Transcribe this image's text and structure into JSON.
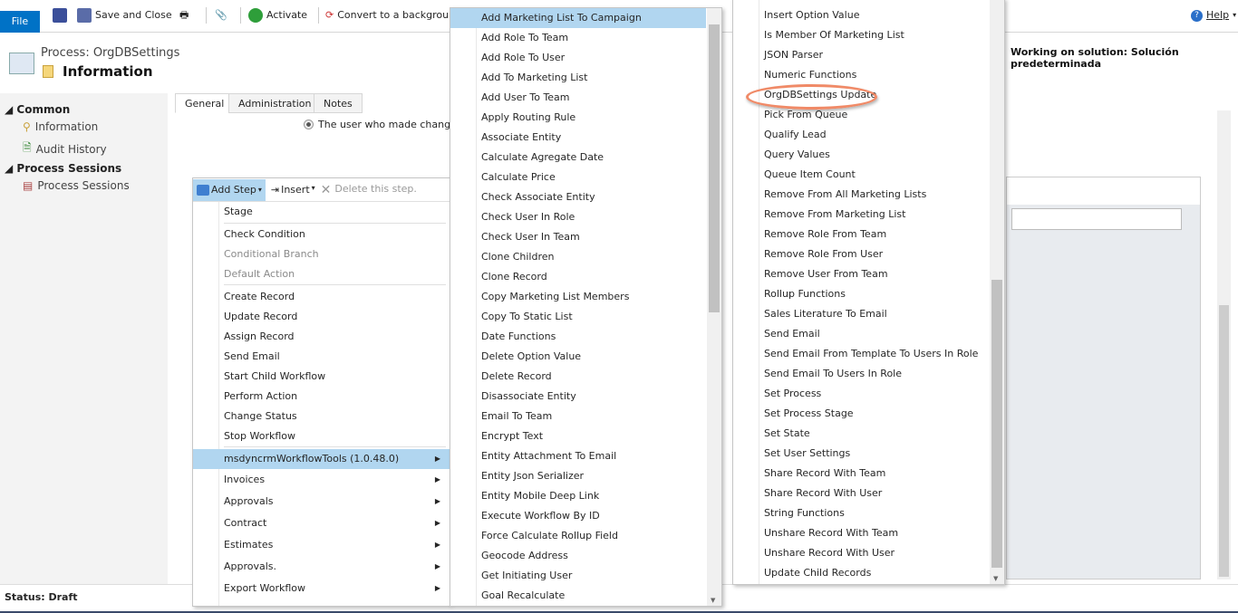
{
  "ribbon": {
    "file": "File",
    "save_and_close": "Save and Close",
    "activate": "Activate",
    "convert": "Convert to a background",
    "help": "Help"
  },
  "header": {
    "process": "Process: OrgDBSettings",
    "section": "Information",
    "solution": "Working on solution: Solución predeterminada"
  },
  "nav": {
    "groups": [
      {
        "title": "Common",
        "items": [
          "Information",
          "Audit History"
        ]
      },
      {
        "title": "Process Sessions",
        "items": [
          "Process Sessions"
        ]
      }
    ]
  },
  "tabs": [
    "General",
    "Administration",
    "Notes"
  ],
  "form": {
    "radio_label": "The user who made changes t"
  },
  "step_toolbar": {
    "add_step": "Add Step",
    "insert": "Insert",
    "delete": "Delete this step."
  },
  "menu1": {
    "items": [
      "Stage",
      "Check Condition",
      "Conditional Branch",
      "Default Action",
      "Create Record",
      "Update Record",
      "Assign Record",
      "Send Email",
      "Start Child Workflow",
      "Perform Action",
      "Change Status",
      "Stop Workflow",
      "msdyncrmWorkflowTools (1.0.48.0)",
      "Invoices",
      "Approvals",
      "Contract",
      "Estimates",
      "Approvals.",
      "Export Workflow"
    ]
  },
  "menu2": {
    "items": [
      "Add Marketing List To Campaign",
      "Add Role To Team",
      "Add Role To User",
      "Add To Marketing List",
      "Add User To Team",
      "Apply Routing Rule",
      "Associate Entity",
      "Calculate Agregate Date",
      "Calculate Price",
      "Check Associate Entity",
      "Check User In Role",
      "Check User In Team",
      "Clone Children",
      "Clone Record",
      "Copy Marketing List Members",
      "Copy To Static List",
      "Date Functions",
      "Delete Option Value",
      "Delete Record",
      "Disassociate Entity",
      "Email To Team",
      "Encrypt Text",
      "Entity Attachment To Email",
      "Entity Json Serializer",
      "Entity Mobile Deep Link",
      "Execute Workflow By ID",
      "Force Calculate Rollup Field",
      "Geocode Address",
      "Get Initiating User",
      "Goal Recalculate"
    ]
  },
  "menu3": {
    "items": [
      "Insert Option Value",
      "Is Member Of Marketing List",
      "JSON Parser",
      "Numeric Functions",
      "OrgDBSettings Update",
      "Pick From Queue",
      "Qualify Lead",
      "Query Values",
      "Queue Item Count",
      "Remove From All Marketing Lists",
      "Remove From Marketing List",
      "Remove Role From Team",
      "Remove Role From User",
      "Remove User From Team",
      "Rollup Functions",
      "Sales Literature To Email",
      "Send Email",
      "Send Email From Template To Users In Role",
      "Send Email To Users In Role",
      "Set Process",
      "Set Process Stage",
      "Set State",
      "Set User Settings",
      "Share Record With Team",
      "Share Record With User",
      "String Functions",
      "Unshare Record With Team",
      "Unshare Record With User",
      "Update Child Records"
    ],
    "highlighted": "OrgDBSettings Update",
    "highlight_color": "#f08a67"
  },
  "status": "Status: Draft"
}
